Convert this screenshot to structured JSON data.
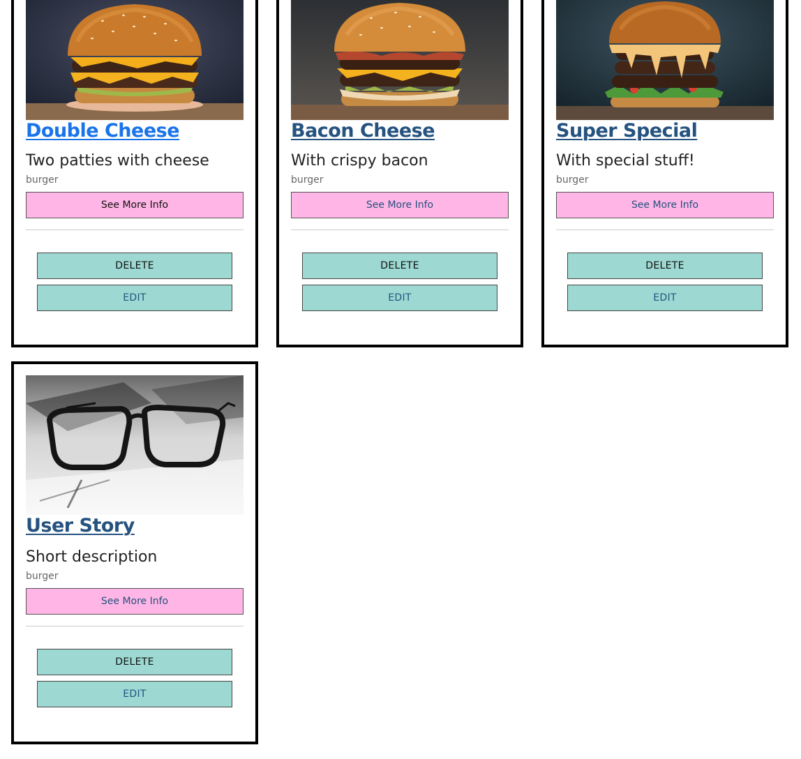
{
  "cards": [
    {
      "title": "Double Cheese",
      "description": "Two patties with cheese",
      "category": "burger",
      "info_label": "See More Info",
      "delete_label": "DELETE",
      "edit_label": "EDIT",
      "image_icon": "burger-photo"
    },
    {
      "title": "Bacon Cheese",
      "description": "With crispy bacon",
      "category": "burger",
      "info_label": "See More Info",
      "delete_label": "DELETE",
      "edit_label": "EDIT",
      "image_icon": "burger-photo"
    },
    {
      "title": "Super Special",
      "description": "With special stuff!",
      "category": "burger",
      "info_label": "See More Info",
      "delete_label": "DELETE",
      "edit_label": "EDIT",
      "image_icon": "burger-photo"
    },
    {
      "title": "User Story",
      "description": "Short description",
      "category": "burger",
      "info_label": "See More Info",
      "delete_label": "DELETE",
      "edit_label": "EDIT",
      "image_icon": "glasses-photo"
    }
  ],
  "colors": {
    "title_link": "#25527f",
    "title_link_active": "#1a73e8",
    "info_button_bg": "#ffb6e6",
    "action_button_bg": "#9dd9d2",
    "card_border": "#000000"
  }
}
